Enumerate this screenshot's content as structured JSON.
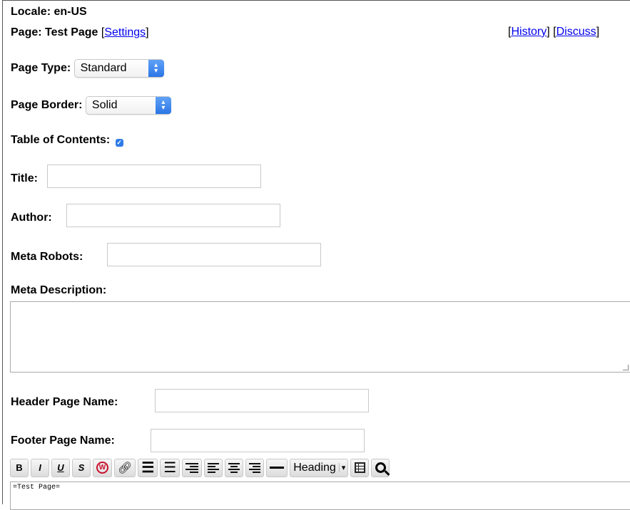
{
  "header": {
    "locale_label": "Locale:",
    "locale_value": "en-US",
    "page_label": "Page:",
    "page_value": "Test Page",
    "settings_link": "Settings",
    "history_link": "History",
    "discuss_link": "Discuss"
  },
  "form": {
    "page_type_label": "Page Type:",
    "page_type_value": "Standard",
    "page_border_label": "Page Border:",
    "page_border_value": "Solid",
    "toc_label": "Table of Contents:",
    "toc_checked": true,
    "title_label": "Title:",
    "title_value": "",
    "author_label": "Author:",
    "author_value": "",
    "meta_robots_label": "Meta Robots:",
    "meta_robots_value": "",
    "meta_description_label": "Meta Description:",
    "meta_description_value": "",
    "header_page_label": "Header Page Name:",
    "header_page_value": "",
    "footer_page_label": "Footer Page Name:",
    "footer_page_value": ""
  },
  "toolbar": {
    "bold": "B",
    "italic": "I",
    "underline": "U",
    "strike": "S",
    "wiki": "W",
    "heading_label": "Heading",
    "icons": [
      "bold-icon",
      "italic-icon",
      "underline-icon",
      "strikethrough-icon",
      "wikipedia-link-icon",
      "link-icon",
      "bullet-list-icon",
      "numbered-list-icon",
      "indent-icon",
      "align-left-icon",
      "align-center-icon",
      "align-right-icon",
      "horizontal-rule-icon",
      "table-icon",
      "search-icon"
    ]
  },
  "editor": {
    "content": "=Test Page="
  },
  "colors": {
    "link": "#0000ee",
    "select_arrow": "#2b76e6",
    "wiki_red": "#c8102e"
  }
}
